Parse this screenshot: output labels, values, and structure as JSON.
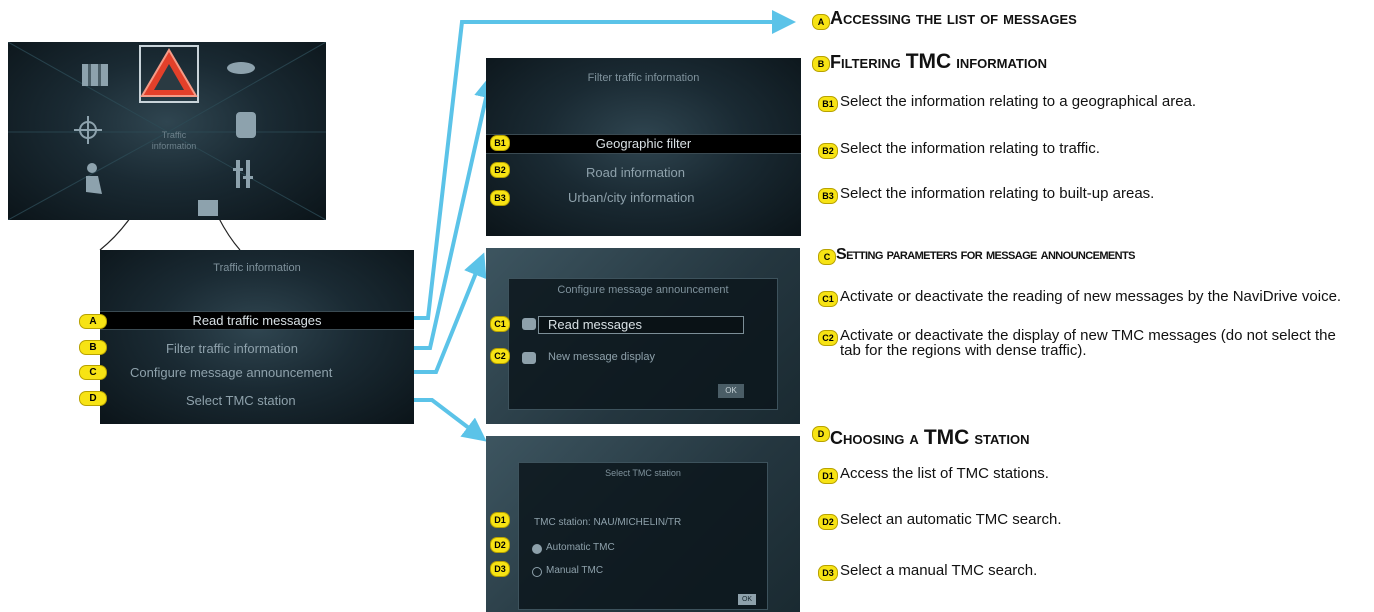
{
  "main_menu": {
    "traffic_label_line1": "Traffic",
    "traffic_label_line2": "information"
  },
  "traffic_screen": {
    "title": "Traffic information",
    "items": [
      {
        "badge": "A",
        "label": "Read traffic messages"
      },
      {
        "badge": "B",
        "label": "Filter traffic information"
      },
      {
        "badge": "C",
        "label": "Configure message announcement"
      },
      {
        "badge": "D",
        "label": "Select TMC station"
      }
    ]
  },
  "filter_screen": {
    "title": "Filter traffic information",
    "items": [
      {
        "badge": "B1",
        "label": "Geographic filter"
      },
      {
        "badge": "B2",
        "label": "Road information"
      },
      {
        "badge": "B3",
        "label": "Urban/city information"
      }
    ]
  },
  "configure_screen": {
    "title": "Configure message announcement",
    "items": [
      {
        "badge": "C1",
        "label": "Read messages"
      },
      {
        "badge": "C2",
        "label": "New message display"
      }
    ],
    "ok": "OK"
  },
  "tmc_screen": {
    "title": "Select TMC station",
    "items": [
      {
        "badge": "D1",
        "label": "TMC station:   NAU/MICHELIN/TR"
      },
      {
        "badge": "D2",
        "label": "Automatic TMC"
      },
      {
        "badge": "D3",
        "label": "Manual TMC"
      }
    ],
    "ok": "OK"
  },
  "sections": {
    "a": {
      "badge": "A",
      "heading": "Accessing the list of messages"
    },
    "b": {
      "badge": "B",
      "heading_pre": "Filtering",
      "heading_big": "TMC",
      "heading_post": "information",
      "items": [
        {
          "badge": "B1",
          "text": "Select the information relating to a geographical area."
        },
        {
          "badge": "B2",
          "text": "Select the information relating to traffic."
        },
        {
          "badge": "B3",
          "text": "Select the information relating to built-up areas."
        }
      ]
    },
    "c": {
      "badge": "C",
      "heading": "Setting parameters for message announcements",
      "items": [
        {
          "badge": "C1",
          "text": "Activate or deactivate the reading of new messages by the NaviDrive voice."
        },
        {
          "badge": "C2",
          "text": "Activate or deactivate the display of new TMC messages (do not select the tab for the regions with dense traffic)."
        }
      ]
    },
    "d": {
      "badge": "D",
      "heading_pre": "Choosing a",
      "heading_big": "TMC",
      "heading_post": "station",
      "items": [
        {
          "badge": "D1",
          "text": "Access the list of TMC stations."
        },
        {
          "badge": "D2",
          "text": "Select an automatic TMC search."
        },
        {
          "badge": "D3",
          "text": "Select a manual TMC search."
        }
      ]
    }
  },
  "colors": {
    "arrow": "#5bc3e8",
    "badge": "#f7e314",
    "highlight": "#e3402a"
  }
}
